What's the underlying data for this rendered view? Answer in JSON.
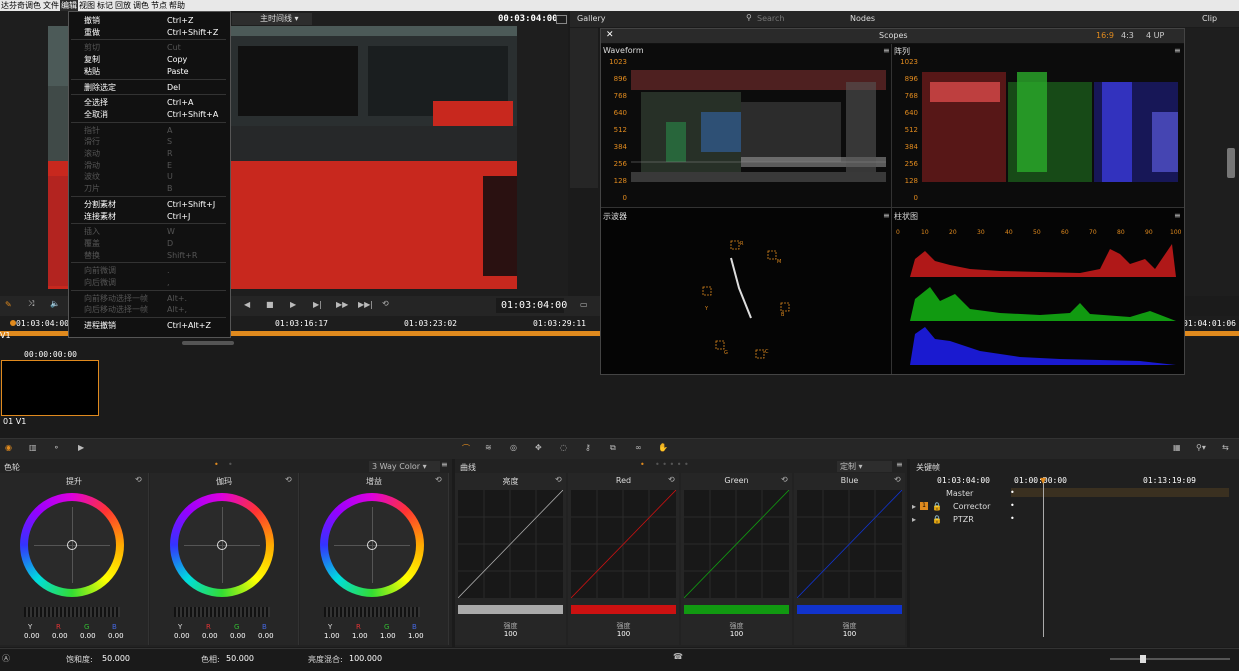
{
  "menubar": {
    "items": [
      "达芬奇调色",
      "文件",
      "编辑",
      "视图",
      "标记",
      "回放",
      "调色",
      "节点",
      "帮助"
    ],
    "active": "编辑"
  },
  "edit_menu": {
    "items": [
      {
        "label": "撤销",
        "shortcut": "Ctrl+Z",
        "enabled": true
      },
      {
        "label": "重做",
        "shortcut": "Ctrl+Shift+Z",
        "enabled": true
      },
      {
        "label": "剪切",
        "shortcut": "Cut",
        "enabled": false
      },
      {
        "label": "复制",
        "shortcut": "Copy",
        "enabled": true
      },
      {
        "label": "粘贴",
        "shortcut": "Paste",
        "enabled": true
      },
      {
        "label": "删除选定",
        "shortcut": "Del",
        "enabled": true
      },
      {
        "label": "全选择",
        "shortcut": "Ctrl+A",
        "enabled": true
      },
      {
        "label": "全取消",
        "shortcut": "Ctrl+Shift+A",
        "enabled": true
      },
      {
        "label": "指针",
        "shortcut": "A",
        "enabled": false
      },
      {
        "label": "滑行",
        "shortcut": "S",
        "enabled": false
      },
      {
        "label": "滚动",
        "shortcut": "R",
        "enabled": false
      },
      {
        "label": "滑动",
        "shortcut": "E",
        "enabled": false
      },
      {
        "label": "波纹",
        "shortcut": "U",
        "enabled": false
      },
      {
        "label": "刀片",
        "shortcut": "B",
        "enabled": false
      },
      {
        "label": "分割素材",
        "shortcut": "Ctrl+Shift+J",
        "enabled": true
      },
      {
        "label": "连接素材",
        "shortcut": "Ctrl+J",
        "enabled": true
      },
      {
        "label": "插入",
        "shortcut": "W",
        "enabled": false
      },
      {
        "label": "覆盖",
        "shortcut": "D",
        "enabled": false
      },
      {
        "label": "替换",
        "shortcut": "Shift+R",
        "enabled": false
      },
      {
        "label": "向前微调",
        "shortcut": ".",
        "enabled": false
      },
      {
        "label": "向后微调",
        "shortcut": ",",
        "enabled": false
      },
      {
        "label": "向前移动选择一帧",
        "shortcut": "Alt+.",
        "enabled": false
      },
      {
        "label": "向后移动选择一帧",
        "shortcut": "Alt+,",
        "enabled": false
      },
      {
        "label": "进程撤销",
        "shortcut": "Ctrl+Alt+Z",
        "enabled": true
      }
    ]
  },
  "viewer": {
    "timeline_select": "主时间线",
    "timecode_top": "00:03:04:00",
    "timecode_bottom": "01:03:04:00"
  },
  "timeline_ruler": {
    "ticks": [
      "01:03:04:00",
      "01:03:16:17",
      "01:03:23:02",
      "01:03:29:11",
      "01:04:01:06"
    ]
  },
  "clip": {
    "timecode": "00:00:00:00",
    "label": "01  V1",
    "track": "V1"
  },
  "gallery": {
    "label": "Gallery",
    "search_placeholder": "Search",
    "nodes": "Nodes",
    "clip": "Clip"
  },
  "scopes": {
    "title": "Scopes",
    "ratios": [
      "16:9",
      "4:3"
    ],
    "layout": "4 UP",
    "waveform": {
      "title": "Waveform",
      "scale": [
        "1023",
        "896",
        "768",
        "640",
        "512",
        "384",
        "256",
        "128",
        "0"
      ]
    },
    "parade": {
      "title": "阵列",
      "scale": [
        "1023",
        "896",
        "768",
        "640",
        "512",
        "384",
        "256",
        "128",
        "0"
      ]
    },
    "vectorscope": {
      "title": "示波器",
      "targets": [
        "R",
        "M",
        "B",
        "C",
        "G",
        "Y"
      ]
    },
    "histogram": {
      "title": "柱状图",
      "scale": [
        "0",
        "10",
        "20",
        "30",
        "40",
        "50",
        "60",
        "70",
        "80",
        "90",
        "100"
      ]
    }
  },
  "color_panel": {
    "tabs_icons": [
      "color-wheel-icon",
      "bars-icon",
      "nodes-icon",
      "camera-icon"
    ],
    "title": "色轮",
    "mode": "3 Way Color",
    "wheels": [
      {
        "title": "提升",
        "values": {
          "Y": "0.00",
          "R": "0.00",
          "G": "0.00",
          "B": "0.00"
        }
      },
      {
        "title": "伽玛",
        "values": {
          "Y": "0.00",
          "R": "0.00",
          "G": "0.00",
          "B": "0.00"
        }
      },
      {
        "title": "增益",
        "values": {
          "Y": "1.00",
          "R": "1.00",
          "G": "1.00",
          "B": "1.00"
        }
      }
    ],
    "channel_labels": [
      "Y",
      "R",
      "G",
      "B"
    ],
    "footer": {
      "saturation_label": "饱和度:",
      "saturation": "50.000",
      "hue_label": "色相:",
      "hue": "50.000",
      "lum_mix_label": "亮度混合:",
      "lum_mix": "100.000"
    }
  },
  "curves": {
    "title": "曲线",
    "preset": "定制",
    "channels": [
      {
        "name": "亮度",
        "intensity_label": "强度",
        "intensity": "100",
        "color": "#aaaaaa"
      },
      {
        "name": "Red",
        "intensity_label": "强度",
        "intensity": "100",
        "color": "#cc1111"
      },
      {
        "name": "Green",
        "intensity_label": "强度",
        "intensity": "100",
        "color": "#119911"
      },
      {
        "name": "Blue",
        "intensity_label": "强度",
        "intensity": "100",
        "color": "#1133cc"
      }
    ]
  },
  "keyframes": {
    "title": "关键帧",
    "timecode_left": "01:03:04:00",
    "timecode_mid": "01:00:00:00",
    "timecode_right": "01:13:19:09",
    "rows": [
      "Master",
      "Corrector",
      "PTZR"
    ]
  },
  "colors": {
    "accent": "#e08a1e",
    "bus_red": "#c8281e"
  }
}
